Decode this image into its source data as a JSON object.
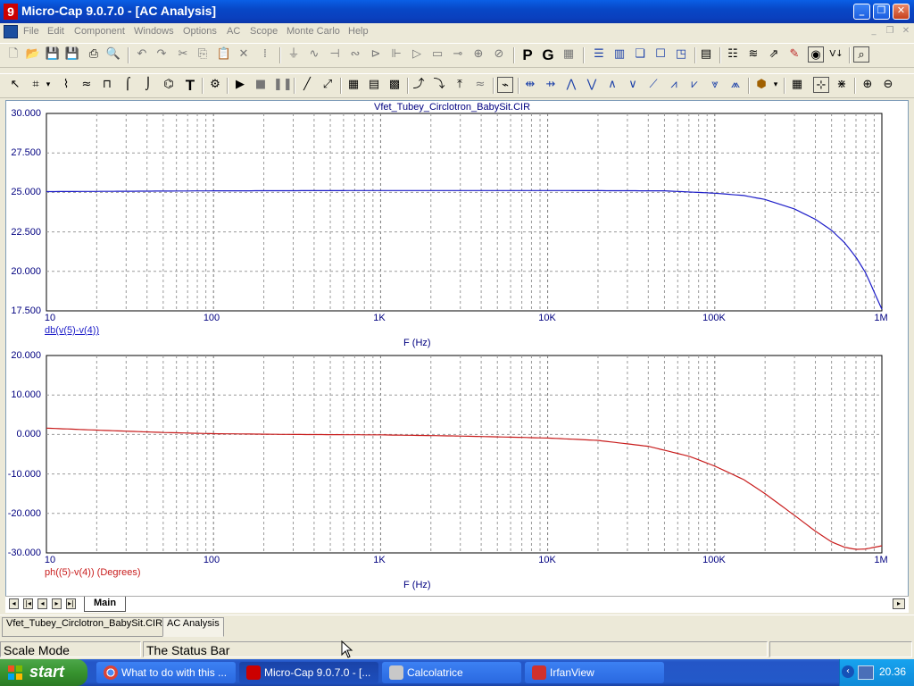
{
  "window": {
    "title": "Micro-Cap 9.0.7.0 - [AC Analysis]",
    "app_icon": "9",
    "controls": [
      "minimize",
      "restore",
      "close"
    ]
  },
  "menu": [
    "File",
    "Edit",
    "Component",
    "Windows",
    "Options",
    "AC",
    "Scope",
    "Monte Carlo",
    "Help"
  ],
  "toolbar": {
    "p_label": "P",
    "g_label": "G",
    "text_tool": "T"
  },
  "colors": {
    "grid_text": "#000080",
    "trace1": "#1c1cc8",
    "trace2": "#c81c1c",
    "grid": "#9a9a9a"
  },
  "plot_title": "Vfet_Tubey_Circlotron_BabySit.CIR",
  "chart_data": [
    {
      "type": "line",
      "title": "Vfet_Tubey_Circlotron_BabySit.CIR",
      "xlabel": "F (Hz)",
      "ylabel": "db(v(5)-v(4))",
      "xscale": "log",
      "xlim": [
        10,
        1000000
      ],
      "ylim": [
        17.5,
        30
      ],
      "y_ticks": [
        "30.000",
        "27.500",
        "25.000",
        "22.500",
        "20.000",
        "17.500"
      ],
      "x_ticks": [
        "10",
        "100",
        "1K",
        "10K",
        "100K",
        "1M"
      ],
      "grid": true,
      "series": [
        {
          "name": "db(v(5)-v(4))",
          "x": [
            10,
            100,
            1000,
            10000,
            50000,
            100000,
            150000,
            200000,
            300000,
            400000,
            500000,
            600000,
            700000,
            800000,
            1000000
          ],
          "y": [
            25.05,
            25.1,
            25.12,
            25.12,
            25.1,
            24.95,
            24.8,
            24.55,
            23.95,
            23.3,
            22.6,
            21.8,
            20.9,
            19.9,
            17.6
          ]
        }
      ]
    },
    {
      "type": "line",
      "xlabel": "F (Hz)",
      "ylabel": "ph((5)-v(4)) (Degrees)",
      "xscale": "log",
      "xlim": [
        10,
        1000000
      ],
      "ylim": [
        -30,
        20
      ],
      "y_ticks": [
        "20.000",
        "10.000",
        "0.000",
        "-10.000",
        "-20.000",
        "-30.000"
      ],
      "x_ticks": [
        "10",
        "100",
        "1K",
        "10K",
        "100K",
        "1M"
      ],
      "grid": true,
      "series": [
        {
          "name": "ph((5)-v(4)) (Degrees)",
          "x": [
            10,
            20,
            50,
            100,
            300,
            1000,
            3000,
            10000,
            20000,
            40000,
            70000,
            100000,
            150000,
            200000,
            300000,
            400000,
            500000,
            600000,
            700000,
            800000,
            1000000
          ],
          "y": [
            1.6,
            1.1,
            0.5,
            0.2,
            0,
            -0.1,
            -0.4,
            -0.9,
            -1.5,
            -3.0,
            -5.5,
            -8.0,
            -11.5,
            -15.0,
            -20.5,
            -24.5,
            -27.2,
            -28.6,
            -29.1,
            -29.0,
            -28.2
          ]
        }
      ]
    }
  ],
  "page_tabs": {
    "active": "Main"
  },
  "doc_tabs": [
    "Vfet_Tubey_Circlotron_BabySit.CIR",
    "AC Analysis"
  ],
  "status": {
    "mode": "Scale Mode",
    "message": "The Status Bar"
  },
  "taskbar": {
    "start": "start",
    "tasks": [
      {
        "label": "What to do with this ...",
        "icon": "chrome-icon"
      },
      {
        "label": "Micro-Cap 9.0.7.0 - [...",
        "icon": "microcap-icon"
      },
      {
        "label": "Calcolatrice",
        "icon": "calculator-icon"
      },
      {
        "label": "IrfanView",
        "icon": "irfanview-icon"
      }
    ],
    "clock": "20.36"
  }
}
